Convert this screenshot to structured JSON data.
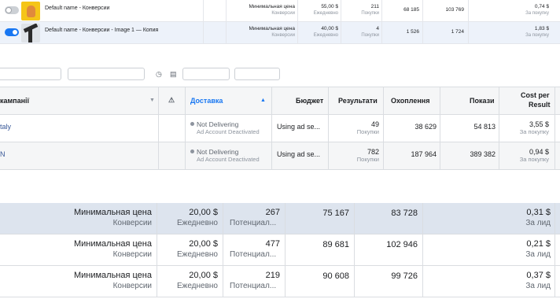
{
  "panel1": {
    "rows": [
      {
        "name": "Default name - Конверсии",
        "bid": "Минимальная цена",
        "bid_sub": "Конверсии",
        "budget": "55,00 $",
        "budget_sub": "Ежедневно",
        "results": "211",
        "results_sub": "Покупки",
        "reach": "68 185",
        "impressions": "103 769",
        "cost": "0,74 $",
        "cost_sub": "За покупку",
        "active": false,
        "thumb": "yellow-person-image"
      },
      {
        "name": "Default name - Конверсии - Image 1 — Копия",
        "bid": "Минимальная цена",
        "bid_sub": "Конверсии",
        "budget": "40,00 $",
        "budget_sub": "Ежедневно",
        "results": "4",
        "results_sub": "Покупки",
        "reach": "1 526",
        "impressions": "1 724",
        "cost": "1,83 $",
        "cost_sub": "За покупку",
        "active": true,
        "thumb": "dark-object-image"
      }
    ]
  },
  "panel2": {
    "headers": {
      "campaign": "кампанії",
      "warning_icon": "⚠",
      "delivery": "Доставка",
      "budget": "Бюджет",
      "results": "Результати",
      "reach": "Охоплення",
      "impressions": "Покази",
      "cost_line1": "Cost per",
      "cost_line2": "Result"
    },
    "rows": [
      {
        "campaign": "taly",
        "status": "Not Delivering",
        "status_sub": "Ad Account Deactivated",
        "budget": "Using ad se...",
        "results": "49",
        "results_sub": "Покупки",
        "reach": "38 629",
        "impressions": "54 813",
        "cost": "3,55 $",
        "cost_sub": "За покупку"
      },
      {
        "campaign": "N",
        "status": "Not Delivering",
        "status_sub": "Ad Account Deactivated",
        "budget": "Using ad se...",
        "results": "782",
        "results_sub": "Покупки",
        "reach": "187 964",
        "impressions": "389 382",
        "cost": "0,94 $",
        "cost_sub": "За покупку"
      }
    ]
  },
  "panel3": {
    "rows": [
      {
        "bid": "Минимальная цена",
        "bid_sub": "Конверсии",
        "budget": "20,00 $",
        "budget_sub": "Ежедневно",
        "results": "267",
        "results_sub": "Потенциал...",
        "reach": "75 167",
        "impressions": "83 728",
        "cost": "0,31 $",
        "cost_sub": "За лид"
      },
      {
        "bid": "Минимальная цена",
        "bid_sub": "Конверсии",
        "budget": "20,00 $",
        "budget_sub": "Ежедневно",
        "results": "477",
        "results_sub": "Потенциал...",
        "reach": "89 681",
        "impressions": "102 946",
        "cost": "0,21 $",
        "cost_sub": "За лид"
      },
      {
        "bid": "Минимальная цена",
        "bid_sub": "Конверсии",
        "budget": "20,00 $",
        "budget_sub": "Ежедневно",
        "results": "219",
        "results_sub": "Потенциал...",
        "reach": "90 608",
        "impressions": "99 726",
        "cost": "0,37 $",
        "cost_sub": "За лид"
      }
    ]
  },
  "colors": {
    "accent": "#1877f2",
    "link": "#385898",
    "header_bg": "#f5f6f7",
    "selected_row_bg": "#dde4ee"
  }
}
